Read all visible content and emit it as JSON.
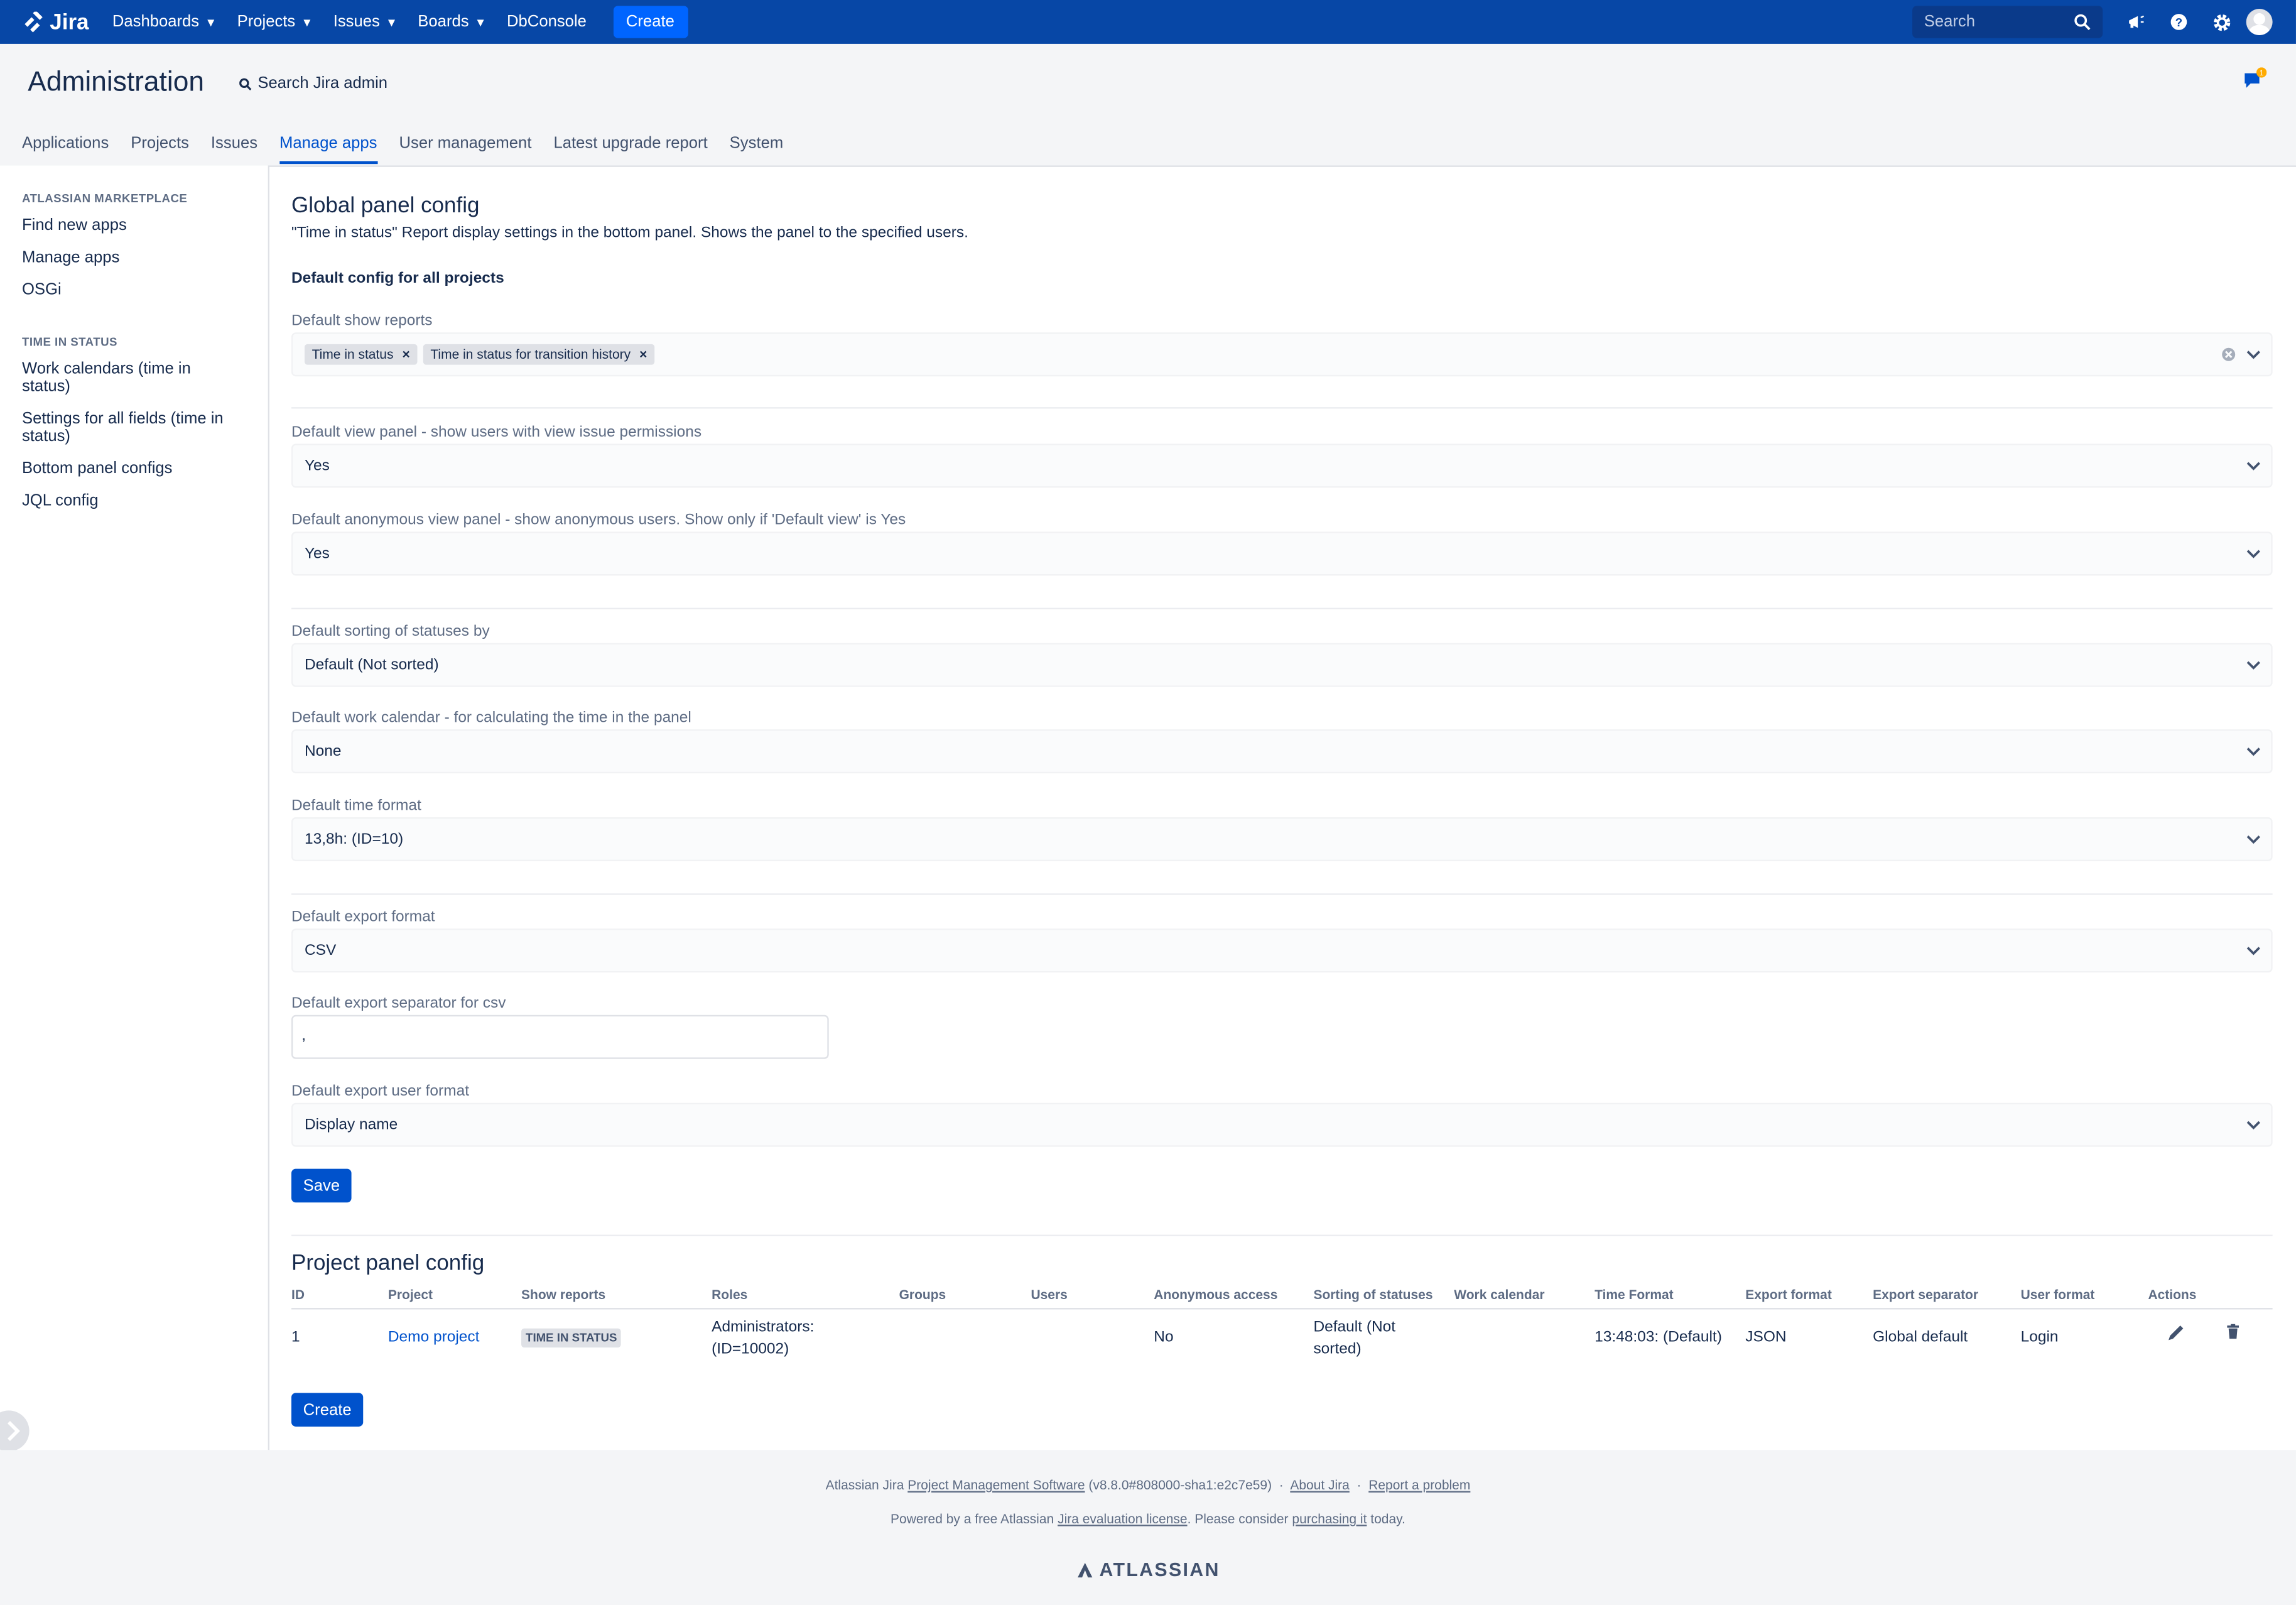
{
  "topnav": {
    "logo_text": "Jira",
    "items": [
      {
        "label": "Dashboards"
      },
      {
        "label": "Projects"
      },
      {
        "label": "Issues"
      },
      {
        "label": "Boards"
      },
      {
        "label": "DbConsole"
      }
    ],
    "create_label": "Create",
    "search_placeholder": "Search",
    "colors": {
      "bar": "#0747a6",
      "create": "#0065ff"
    },
    "notification_badge": "1"
  },
  "admin": {
    "title": "Administration",
    "search_label": "Search Jira admin",
    "tabs": [
      {
        "label": "Applications"
      },
      {
        "label": "Projects"
      },
      {
        "label": "Issues"
      },
      {
        "label": "Manage apps"
      },
      {
        "label": "User management"
      },
      {
        "label": "Latest upgrade report"
      },
      {
        "label": "System"
      }
    ],
    "active_tab": "Manage apps"
  },
  "sidebar": {
    "group1_heading": "ATLASSIAN MARKETPLACE",
    "group1_items": [
      {
        "label": "Find new apps"
      },
      {
        "label": "Manage apps"
      },
      {
        "label": "OSGi"
      }
    ],
    "group2_heading": "TIME IN STATUS",
    "group2_items": [
      {
        "label": "Work calendars (time in status)"
      },
      {
        "label": "Settings for all fields (time in status)"
      },
      {
        "label": "Bottom panel configs"
      },
      {
        "label": "JQL config"
      }
    ]
  },
  "global": {
    "title": "Global panel config",
    "description": "\"Time in status\" Report display settings in the bottom panel. Shows the panel to the specified users.",
    "subheading": "Default config for all projects",
    "show_reports_label": "Default show reports",
    "show_reports_chips": [
      "Time in status",
      "Time in status for transition history"
    ],
    "view_panel_label": "Default view panel - show users with view issue permissions",
    "view_panel_value": "Yes",
    "anon_panel_label": "Default anonymous view panel - show anonymous users. Show only if 'Default view' is Yes",
    "anon_panel_value": "Yes",
    "sorting_label": "Default sorting of statuses by",
    "sorting_value": "Default (Not sorted)",
    "calendar_label": "Default work calendar - for calculating the time in the panel",
    "calendar_value": "None",
    "time_format_label": "Default time format",
    "time_format_value": "13,8h: (ID=10)",
    "export_format_label": "Default export format",
    "export_format_value": "CSV",
    "separator_label": "Default export separator for csv",
    "separator_value": ",",
    "user_format_label": "Default export user format",
    "user_format_value": "Display name",
    "save_label": "Save"
  },
  "project": {
    "title": "Project panel config",
    "columns": [
      "ID",
      "Project",
      "Show reports",
      "Roles",
      "Groups",
      "Users",
      "Anonymous access",
      "Sorting of statuses",
      "Work calendar",
      "Time Format",
      "Export format",
      "Export separator",
      "User format",
      "Actions"
    ],
    "rows": [
      {
        "id": "1",
        "project": "Demo project",
        "show_reports": "TIME IN STATUS",
        "roles": "Administrators: (ID=10002)",
        "groups": "",
        "users": "",
        "anonymous": "No",
        "sorting": "Default (Not sorted)",
        "calendar": "",
        "time_format": "13:48:03: (Default)",
        "export_format": "JSON",
        "export_separator": "Global default",
        "user_format": "Login"
      }
    ],
    "create_label": "Create"
  },
  "footer": {
    "l1_prefix": "Atlassian Jira",
    "l1_link1": "Project Management Software",
    "l1_version": "(v8.8.0#808000-sha1:e2c7e59)",
    "l1_sep": "·",
    "l1_link2": "About Jira",
    "l1_link3": "Report a problem",
    "l2_prefix": "Powered by a free Atlassian",
    "l2_link1": "Jira evaluation license",
    "l2_mid": ". Please consider",
    "l2_link2": "purchasing it",
    "l2_suffix": "today.",
    "brand": "ATLASSIAN"
  }
}
